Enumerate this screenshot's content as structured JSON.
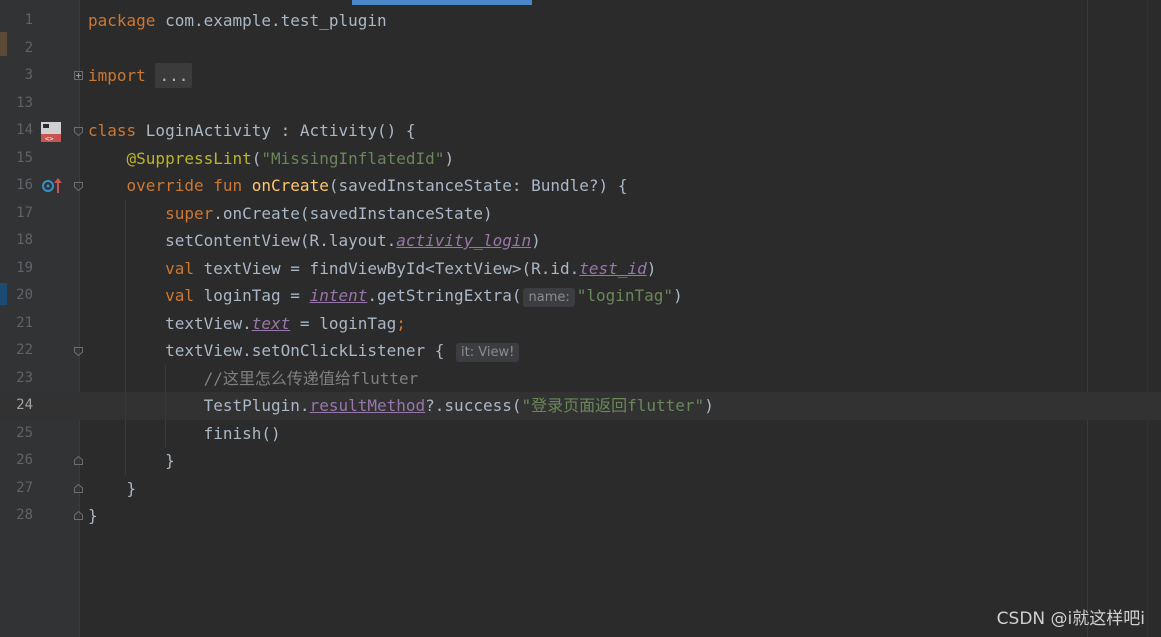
{
  "colors": {
    "background": "#2b2b2b",
    "gutter": "#313335",
    "keyword": "#cc7832",
    "string": "#6a8759",
    "annotation": "#bbb529",
    "function": "#ffc66d",
    "property": "#9876aa",
    "comment": "#808080",
    "text": "#a9b7c6"
  },
  "editor": {
    "current_line_number": "24",
    "lines": [
      {
        "n": "1",
        "tokens": [
          {
            "t": "package ",
            "c": "kw"
          },
          {
            "t": "com.example.test_plugin"
          }
        ]
      },
      {
        "n": "2",
        "tokens": []
      },
      {
        "n": "3",
        "tokens": [
          {
            "t": "import ",
            "c": "kw"
          },
          {
            "t": "...",
            "c": "folded"
          }
        ]
      },
      {
        "n": "13",
        "tokens": []
      },
      {
        "n": "14",
        "tokens": [
          {
            "t": "class ",
            "c": "kw"
          },
          {
            "t": "LoginActivity : Activity() {"
          }
        ]
      },
      {
        "n": "15",
        "tokens": [
          {
            "t": "    "
          },
          {
            "t": "@SuppressLint",
            "c": "ann"
          },
          {
            "t": "("
          },
          {
            "t": "\"MissingInflatedId\"",
            "c": "str"
          },
          {
            "t": ")"
          }
        ]
      },
      {
        "n": "16",
        "tokens": [
          {
            "t": "    "
          },
          {
            "t": "override fun ",
            "c": "kw"
          },
          {
            "t": "onCreate",
            "c": "fn"
          },
          {
            "t": "(savedInstanceState: Bundle?) {"
          }
        ]
      },
      {
        "n": "17",
        "tokens": [
          {
            "t": "        "
          },
          {
            "t": "super",
            "c": "kw"
          },
          {
            "t": ".onCreate(savedInstanceState)"
          }
        ]
      },
      {
        "n": "18",
        "tokens": [
          {
            "t": "        setContentView(R.layout."
          },
          {
            "t": "activity_login",
            "c": "prop"
          },
          {
            "t": ")"
          }
        ]
      },
      {
        "n": "19",
        "tokens": [
          {
            "t": "        "
          },
          {
            "t": "val ",
            "c": "kw"
          },
          {
            "t": "textView = findViewById<TextView>(R.id."
          },
          {
            "t": "test_id",
            "c": "prop"
          },
          {
            "t": ")"
          }
        ]
      },
      {
        "n": "20",
        "tokens": [
          {
            "t": "        "
          },
          {
            "t": "val ",
            "c": "kw"
          },
          {
            "t": "loginTag = "
          },
          {
            "t": "intent",
            "c": "prop"
          },
          {
            "t": ".getStringExtra("
          },
          {
            "t": "name:",
            "c": "hint"
          },
          {
            "t": "\"loginTag\"",
            "c": "str"
          },
          {
            "t": ")"
          }
        ]
      },
      {
        "n": "21",
        "tokens": [
          {
            "t": "        textView."
          },
          {
            "t": "text",
            "c": "prop"
          },
          {
            "t": " = loginTag"
          },
          {
            "t": ";",
            "c": "kw"
          }
        ]
      },
      {
        "n": "22",
        "tokens": [
          {
            "t": "        textView.setOnClickListener { "
          },
          {
            "t": "it: View!",
            "c": "hint"
          }
        ]
      },
      {
        "n": "23",
        "tokens": [
          {
            "t": "            "
          },
          {
            "t": "//这里怎么传递值给flutter",
            "c": "cmt"
          }
        ]
      },
      {
        "n": "24",
        "tokens": [
          {
            "t": "            TestPlugin."
          },
          {
            "t": "resultMethod",
            "c": "propu"
          },
          {
            "t": "?.success("
          },
          {
            "t": "\"登录页面返回flutter\"",
            "c": "str"
          },
          {
            "t": ")"
          }
        ]
      },
      {
        "n": "25",
        "tokens": [
          {
            "t": "            finish()"
          }
        ]
      },
      {
        "n": "26",
        "tokens": [
          {
            "t": "        }"
          }
        ]
      },
      {
        "n": "27",
        "tokens": [
          {
            "t": "    }"
          }
        ]
      },
      {
        "n": "28",
        "tokens": [
          {
            "t": "}"
          }
        ]
      }
    ]
  },
  "gutter_icons": [
    {
      "line": "14",
      "icon": "android-layout-icon"
    },
    {
      "line": "16",
      "icon": "override-method-icon"
    }
  ],
  "watermark": "CSDN @i就这样吧i"
}
